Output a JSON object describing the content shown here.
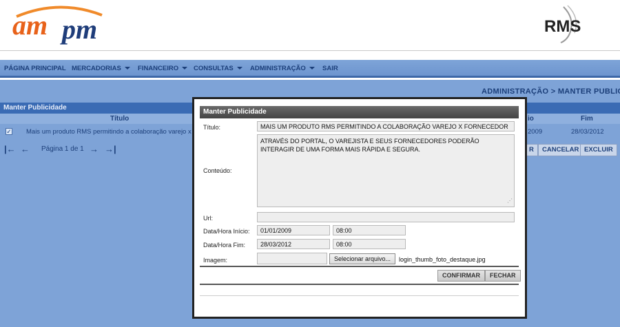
{
  "branding": {
    "left_logo_text": "ampm",
    "right_logo_text": "RMS",
    "accent_orange": "#e8621a",
    "accent_navy": "#1f3d7a"
  },
  "nav": {
    "items": [
      {
        "label": "PÁGINA PRINCIPAL",
        "dropdown": false
      },
      {
        "label": "MERCADORIAS",
        "dropdown": true
      },
      {
        "label": "FINANCEIRO",
        "dropdown": true
      },
      {
        "label": "CONSULTAS",
        "dropdown": true
      },
      {
        "label": "ADMINISTRAÇÃO",
        "dropdown": true
      },
      {
        "label": "SAIR",
        "dropdown": false
      }
    ]
  },
  "breadcrumb": "ADMINISTRAÇÃO > MANTER PUBLIC",
  "panel": {
    "title": "Manter Publicidade",
    "columns": {
      "titulo": "Título",
      "inicio": "io",
      "fim": "Fim"
    },
    "row": {
      "checked": true,
      "titulo": "Mais um produto RMS permitindo a colaboração varejo x forn",
      "inicio": "2009",
      "fim": "28/03/2012"
    },
    "pager": {
      "first_icon": "first-page-icon",
      "prev_icon": "prev-page-icon",
      "text": "Página 1 de 1",
      "next_icon": "next-page-icon",
      "last_icon": "last-page-icon"
    },
    "buttons": {
      "partial": "R",
      "cancelar": "CANCELAR",
      "excluir": "EXCLUIR"
    }
  },
  "modal": {
    "title": "Manter Publicidade",
    "titulo_label": "Título:",
    "titulo_value": "MAIS UM PRODUTO RMS PERMITINDO A COLABORAÇÃO VAREJO X FORNECEDOR",
    "conteudo_label": "Conteúdo:",
    "conteudo_value": "ATRAVÉS DO PORTAL, O VAREJISTA E SEUS FORNECEDORES PODERÃO INTERAGIR DE UMA FORMA MAIS RÁPIDA E SEGURA.",
    "url_label": "Url:",
    "url_value": "",
    "inicio_label": "Data/Hora Início:",
    "inicio_date": "01/01/2009",
    "inicio_time": "08:00",
    "fim_label": "Data/Hora Fim:",
    "fim_date": "28/03/2012",
    "fim_time": "08:00",
    "imagem_label": "Imagem:",
    "file_button": "Selecionar arquivo...",
    "file_name": "login_thumb_foto_destaque.jpg",
    "confirmar": "CONFIRMAR",
    "fechar": "FECHAR"
  }
}
